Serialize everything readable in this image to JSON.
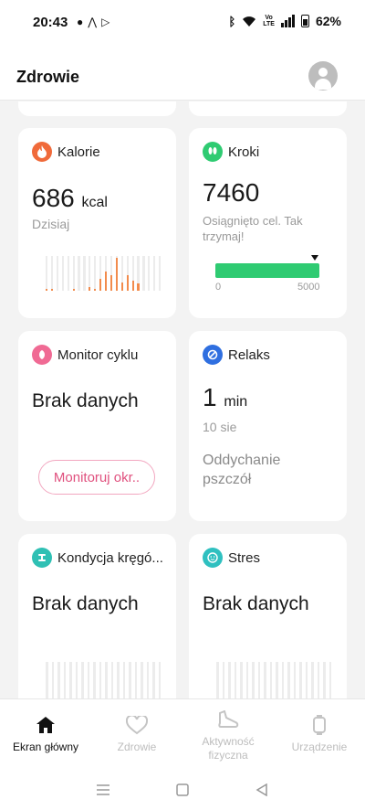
{
  "status": {
    "time": "20:43",
    "battery": "62%",
    "volte": "Vo LTE"
  },
  "app": {
    "title": "Zdrowie"
  },
  "cards": {
    "calories": {
      "title": "Kalorie",
      "value": "686",
      "unit": "kcal",
      "subtitle": "Dzisiaj",
      "icon": "flame-icon",
      "color": "#f06a3a",
      "bars": [
        0.05,
        0.05,
        0,
        0,
        0,
        0.05,
        0,
        0,
        0.1,
        0.05,
        0.35,
        0.55,
        0.45,
        0.95,
        0.25,
        0.45,
        0.3,
        0.2,
        0,
        0,
        0,
        0
      ]
    },
    "steps": {
      "title": "Kroki",
      "value": "7460",
      "subtitle": "Osiągnięto cel. Tak trzymaj!",
      "goal_min": "0",
      "goal_max": "5000",
      "progress": 1.0,
      "icon": "footsteps-icon",
      "color": "#2fcb72"
    },
    "cycle": {
      "title": "Monitor cyklu",
      "nodata": "Brak danych",
      "button": "Monitoruj okr..",
      "icon": "cycle-icon",
      "color": "#f06a94"
    },
    "relax": {
      "title": "Relaks",
      "value": "1",
      "unit": "min",
      "date": "10 sie",
      "activity": "Oddychanie pszczół",
      "icon": "relax-icon",
      "color": "#2f6fe0"
    },
    "spine": {
      "title": "Kondycja kręgó...",
      "nodata": "Brak danych",
      "icon": "spine-icon",
      "color": "#2fc0b4"
    },
    "stress": {
      "title": "Stres",
      "nodata": "Brak danych",
      "icon": "stress-icon",
      "color": "#2fc0c0"
    }
  },
  "nav": [
    {
      "label": "Ekran główny",
      "icon": "home-icon"
    },
    {
      "label": "Zdrowie",
      "icon": "heart-icon"
    },
    {
      "label": "Aktywność fizyczna",
      "icon": "shoe-icon"
    },
    {
      "label": "Urządzenie",
      "icon": "watch-icon"
    }
  ]
}
